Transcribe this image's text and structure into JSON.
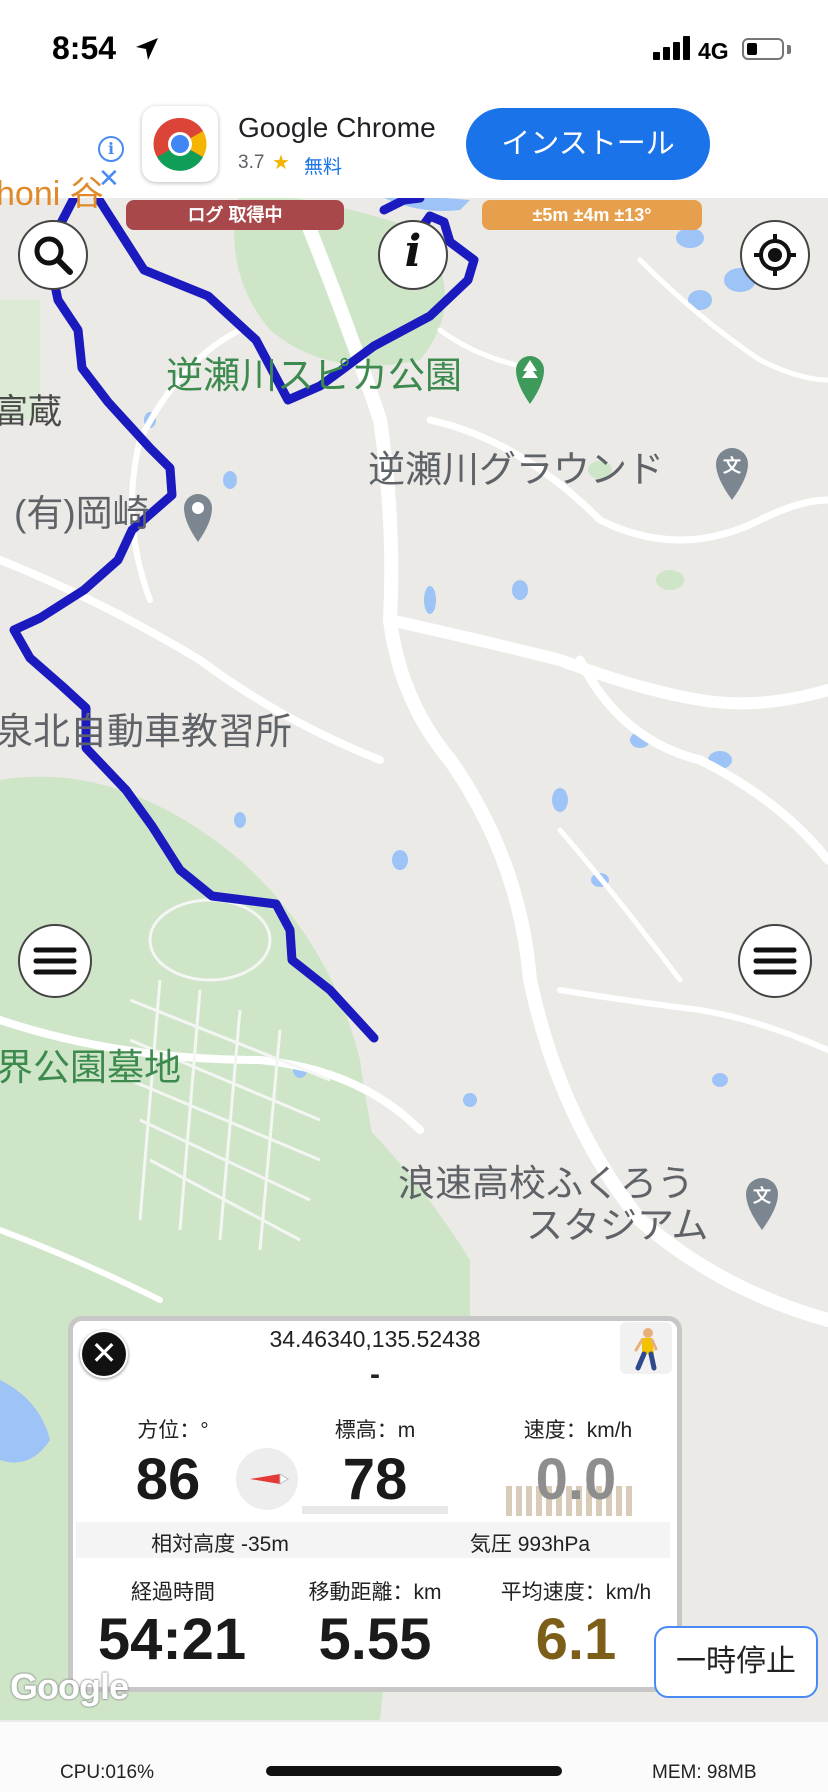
{
  "status_bar": {
    "time": "8:54",
    "network": "4G"
  },
  "ad": {
    "app_name": "Google Chrome",
    "rating": "3.7",
    "price": "無料",
    "install_label": "インストール"
  },
  "map_overlay": {
    "log_status": "ログ 取得中",
    "accuracy": "±5m ±4m ±13°"
  },
  "map_labels": {
    "park": "逆瀬川スピカ公園",
    "ground": "逆瀬川グラウンド",
    "okazaki": "(有)岡崎",
    "school": "泉北自動車教習所",
    "cemetery": "界公園墓地",
    "stadium_line1": "浪速高校ふくろう",
    "stadium_line2": "スタジアム",
    "tomikura": "富蔵",
    "partial": "honi 谷"
  },
  "panel": {
    "coordinates": "34.46340,135.52438",
    "place": "-",
    "heading_label": "方位：°",
    "heading_value": "86",
    "altitude_label": "標高：m",
    "altitude_value": "78",
    "speed_label": "速度：km/h",
    "speed_value": "0.0",
    "relative_altitude": "相対高度 -35m",
    "pressure": "気圧 993hPa",
    "elapsed_label": "経過時間",
    "elapsed_value": "54:21",
    "distance_label": "移動距離：km",
    "distance_value": "5.55",
    "avg_speed_label": "平均速度：km/h",
    "avg_speed_value": "6.1"
  },
  "pause_label": "一時停止",
  "google_logo": "Google",
  "footer": {
    "cpu": "CPU:016%",
    "mem": "MEM: 98MB"
  },
  "icons": [
    "location-arrow-icon",
    "signal-icon",
    "battery-icon",
    "info-icon",
    "close-icon",
    "chrome-logo-icon",
    "star-icon",
    "search-icon",
    "info-italic-icon",
    "locate-icon",
    "menu-icon",
    "park-pin-icon",
    "school-pin-icon",
    "place-pin-icon",
    "walker-icon",
    "compass-icon"
  ],
  "colors": {
    "track": "#1a1abf",
    "water": "#9dc3f7",
    "park": "#c9e3c4",
    "accent": "#1a73e8",
    "avg_speed": "#7d5e18"
  }
}
